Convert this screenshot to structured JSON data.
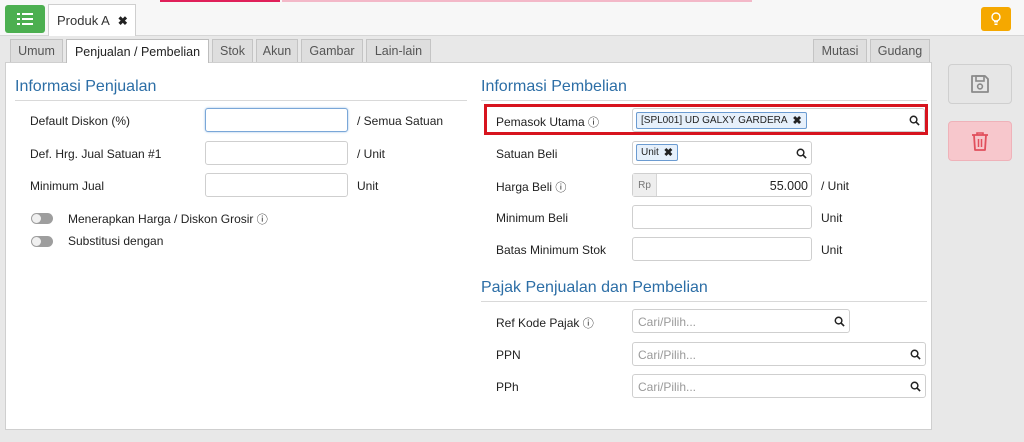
{
  "topbar": {
    "doc_tab_title": "Produk A",
    "close_glyph": "✖"
  },
  "tabs": [
    {
      "label": "Umum"
    },
    {
      "label": "Penjualan / Pembelian"
    },
    {
      "label": "Stok"
    },
    {
      "label": "Akun"
    },
    {
      "label": "Gambar"
    },
    {
      "label": "Lain-lain"
    },
    {
      "label": "Mutasi"
    },
    {
      "label": "Gudang"
    }
  ],
  "sales": {
    "title": "Informasi Penjualan",
    "default_discount_label": "Default Diskon (%)",
    "default_discount_suffix": "/ Semua Satuan",
    "default_price_label": "Def. Hrg. Jual Satuan #1",
    "default_price_suffix": "/ Unit",
    "minimum_sale_label": "Minimum Jual",
    "minimum_sale_suffix": "Unit",
    "wholesale_toggle_label": "Menerapkan Harga / Diskon Grosir",
    "substitution_toggle_label": "Substitusi dengan"
  },
  "purchase": {
    "title": "Informasi Pembelian",
    "main_supplier_label": "Pemasok Utama",
    "main_supplier_tag": "[SPL001] UD GALXY GARDERA",
    "purchase_unit_label": "Satuan Beli",
    "purchase_unit_tag": "Unit",
    "purchase_price_label": "Harga Beli",
    "currency_prefix": "Rp",
    "purchase_price_value": "55.000",
    "purchase_price_suffix": "/ Unit",
    "minimum_purchase_label": "Minimum Beli",
    "minimum_purchase_suffix": "Unit",
    "min_stock_label": "Batas Minimum Stok",
    "min_stock_suffix": "Unit"
  },
  "tax": {
    "title": "Pajak Penjualan dan Pembelian",
    "tax_code_label": "Ref Kode Pajak",
    "ppn_label": "PPN",
    "pph_label": "PPh",
    "placeholder": "Cari/Pilih..."
  },
  "info_glyph": "ⓘ",
  "colors": {
    "accent_blue": "#2c6ea6",
    "menu_green": "#4caf50",
    "hint_orange": "#f5a800",
    "highlight_red": "#d7141e",
    "delete_pink": "#f7c7cc"
  }
}
